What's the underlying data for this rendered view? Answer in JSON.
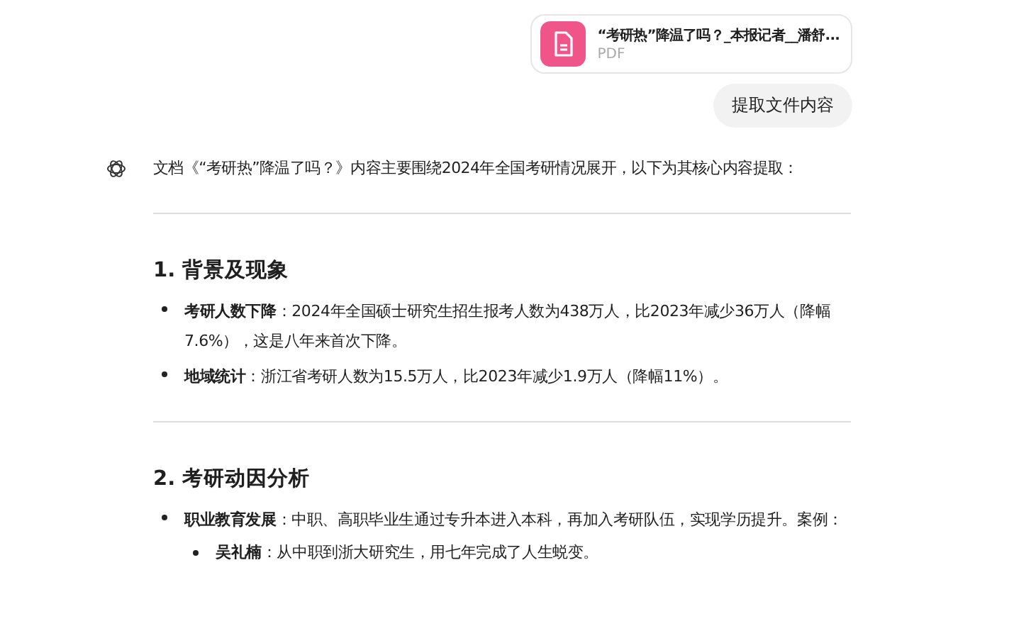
{
  "attachment": {
    "name": "“考研热”降温了吗？_本报记者__潘舒...",
    "type": "PDF"
  },
  "user_message": "提取文件内容",
  "reply": {
    "intro": "文档《“考研热”降温了吗？》内容主要围绕2024年全国考研情况展开，以下为其核心内容提取：",
    "sections": [
      {
        "heading": "1. 背景及现象",
        "items": [
          {
            "text": "**考研人数下降**：2024年全国硕士研究生招生报考人数为438万人，比2023年减少36万人（降幅7.6%），这是八年来首次下降。"
          },
          {
            "text": "**地域统计**：浙江省考研人数为15.5万人，比2023年减少1.9万人（降幅11%）。"
          }
        ]
      },
      {
        "heading": "2. 考研动因分析",
        "items": [
          {
            "text": "**职业教育发展**：中职、高职毕业生通过专升本进入本科，再加入考研队伍，实现学历提升。案例：",
            "children": [
              {
                "text": "**吴礼楠**：从中职到浙大研究生，用七年完成了人生蜕变。"
              }
            ]
          }
        ]
      }
    ]
  }
}
